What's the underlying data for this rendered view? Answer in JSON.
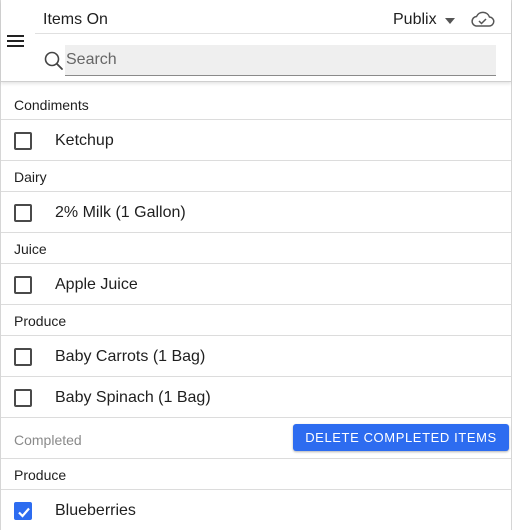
{
  "header": {
    "title": "Items On",
    "store": "Publix",
    "icons": {
      "menu": "hamburger-menu-icon",
      "dropdown": "caret-down-icon",
      "sync": "cloud-icon",
      "search": "search-icon"
    }
  },
  "search": {
    "placeholder": "Search",
    "value": ""
  },
  "sections": [
    {
      "name": "Condiments",
      "items": [
        {
          "label": "Ketchup",
          "checked": false
        }
      ]
    },
    {
      "name": "Dairy",
      "items": [
        {
          "label": "2% Milk (1 Gallon)",
          "checked": false
        }
      ]
    },
    {
      "name": "Juice",
      "items": [
        {
          "label": "Apple Juice",
          "checked": false
        }
      ]
    },
    {
      "name": "Produce",
      "items": [
        {
          "label": "Baby Carrots (1 Bag)",
          "checked": false
        },
        {
          "label": "Baby Spinach (1 Bag)",
          "checked": false
        }
      ]
    }
  ],
  "completed": {
    "label": "Completed",
    "delete_button": "DELETE COMPLETED ITEMS",
    "sections": [
      {
        "name": "Produce",
        "items": [
          {
            "label": "Blueberries",
            "checked": true
          }
        ]
      }
    ]
  },
  "colors": {
    "accent": "#2d6cf0",
    "divider": "#dcdcdc",
    "muted_text": "#8a8a8a"
  }
}
